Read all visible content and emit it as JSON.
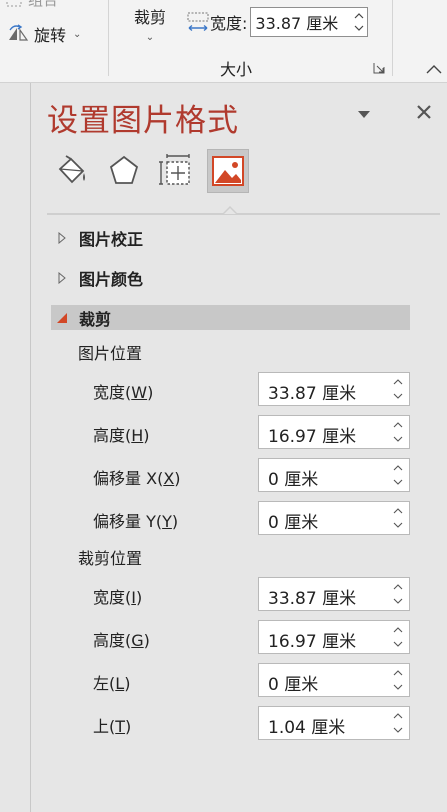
{
  "ribbon": {
    "group_top_label": "组合",
    "rotate_label": "旋转",
    "crop_label": "裁剪",
    "width_label": "宽度:",
    "width_value": "33.87 厘米",
    "size_group_label": "大小"
  },
  "pane": {
    "title": "设置图片格式",
    "tabs": [
      {
        "name": "fill-line",
        "icon": "paint-bucket-icon",
        "active": false
      },
      {
        "name": "effects",
        "icon": "pentagon-icon",
        "active": false
      },
      {
        "name": "size-properties",
        "icon": "size-properties-icon",
        "active": false
      },
      {
        "name": "picture",
        "icon": "picture-icon",
        "active": true
      }
    ],
    "sections": {
      "correction": {
        "label": "图片校正",
        "expanded": false
      },
      "color": {
        "label": "图片颜色",
        "expanded": false
      },
      "crop": {
        "label": "裁剪",
        "expanded": true
      }
    },
    "picture_position": {
      "heading": "图片位置",
      "width": {
        "label": "宽度",
        "key": "W",
        "value": "33.87 厘米"
      },
      "height": {
        "label": "高度",
        "key": "H",
        "value": "16.97 厘米"
      },
      "offset_x": {
        "label": "偏移量 X",
        "key": "X",
        "value": "0 厘米"
      },
      "offset_y": {
        "label": "偏移量 Y",
        "key": "Y",
        "value": "0 厘米"
      }
    },
    "crop_position": {
      "heading": "裁剪位置",
      "width": {
        "label": "宽度",
        "key": "I",
        "value": "33.87 厘米"
      },
      "height": {
        "label": "高度",
        "key": "G",
        "value": "16.97 厘米"
      },
      "left": {
        "label": "左",
        "key": "L",
        "value": "0 厘米"
      },
      "top": {
        "label": "上",
        "key": "T",
        "value": "1.04 厘米"
      }
    }
  },
  "colors": {
    "title": "#b03a2e",
    "accent": "#d24726",
    "active_tab_bg": "#c8c8c8"
  }
}
